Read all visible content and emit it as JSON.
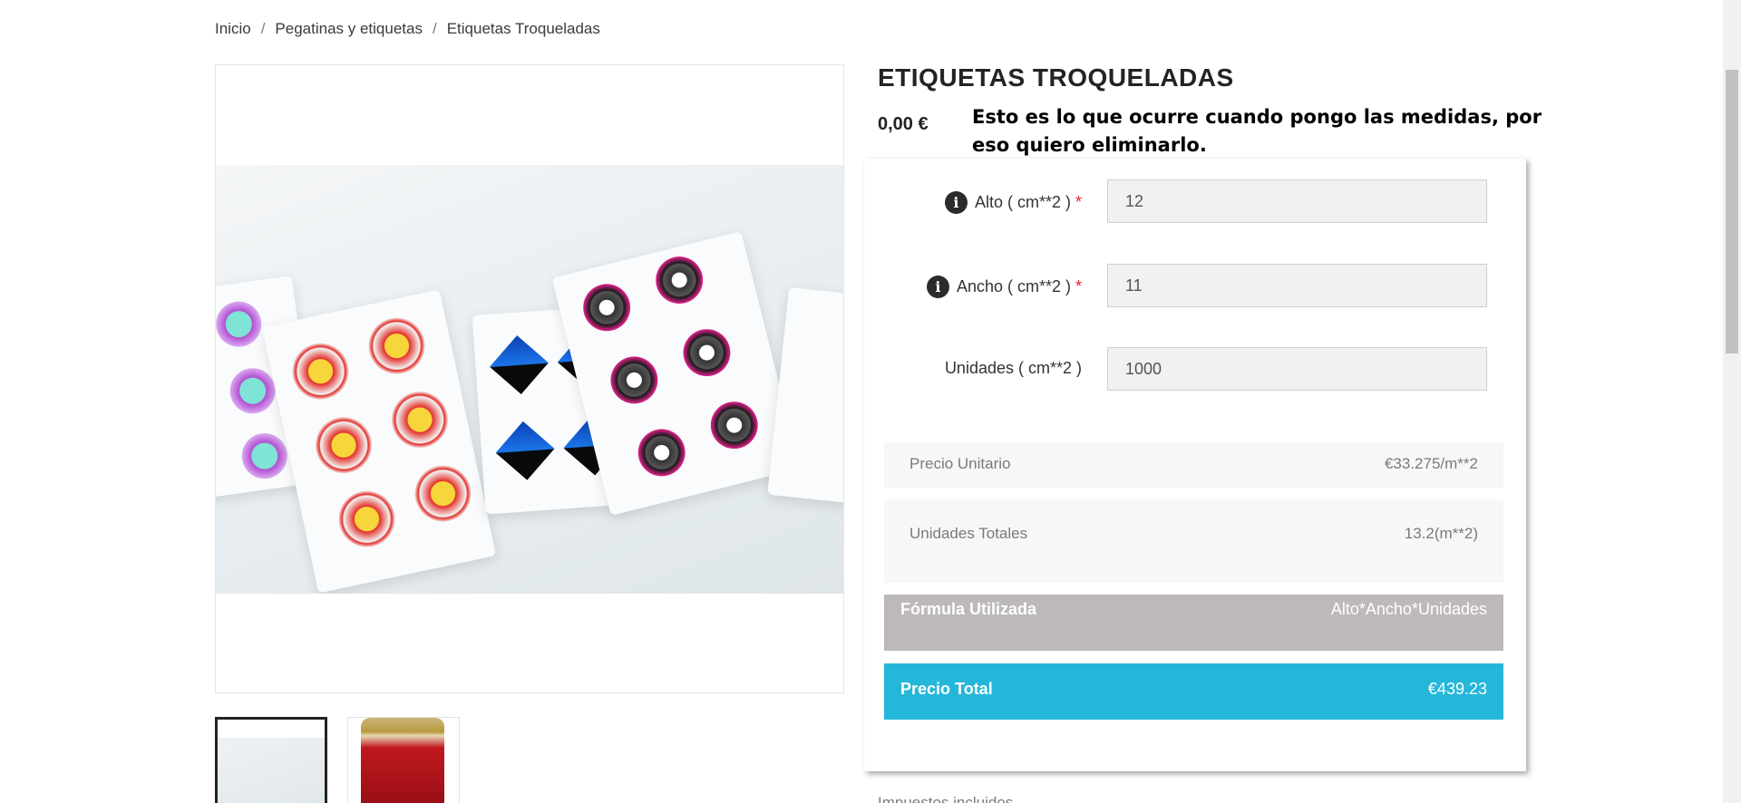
{
  "breadcrumb": {
    "items": [
      "Inicio",
      "Pegatinas y etiquetas",
      "Etiquetas Troqueladas"
    ],
    "separator": "/"
  },
  "product": {
    "title": "ETIQUETAS TROQUELADAS",
    "price": "0,00 €",
    "note": "Esto es lo que ocurre cuando pongo las medidas, por eso quiero eliminarlo.",
    "tax_note": "Impuestos incluidos"
  },
  "calculator": {
    "fields": [
      {
        "label": "Alto ( cm**2 )",
        "required_mark": "*",
        "value": "12",
        "has_info": true
      },
      {
        "label": "Ancho ( cm**2 )",
        "required_mark": "*",
        "value": "11",
        "has_info": true
      },
      {
        "label": "Unidades ( cm**2 )",
        "required_mark": "",
        "value": "1000",
        "has_info": false
      }
    ],
    "unit_price": {
      "label": "Precio Unitario",
      "value": "€33.275/m**2"
    },
    "total_units": {
      "label": "Unidades Totales",
      "value": "13.2(m**2)"
    },
    "formula": {
      "label": "Fórmula Utilizada",
      "value": "Alto*Ancho*Unidades"
    },
    "total_price": {
      "label": "Precio Total",
      "value": "€439.23"
    }
  },
  "icons": {
    "info": "info-icon"
  },
  "colors": {
    "total_bar": "#25b7d9",
    "formula_bar": "#bdb9b9",
    "required": "#e3242b"
  }
}
